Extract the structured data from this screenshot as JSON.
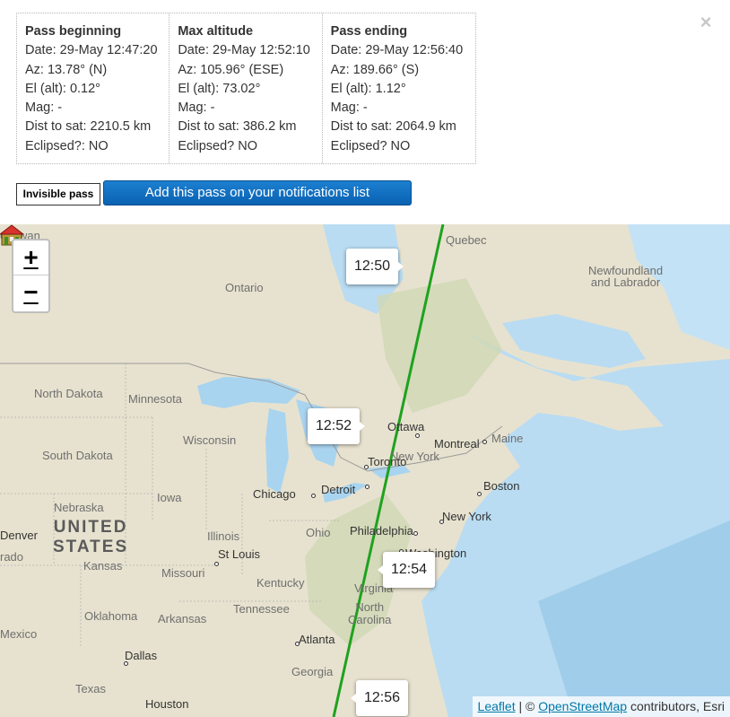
{
  "close": {
    "glyph": "×"
  },
  "pass": {
    "beginning": {
      "title": "Pass beginning",
      "date": "Date: 29-May 12:47:20",
      "az": "Az: 13.78° (N)",
      "el": "El (alt): 0.12°",
      "mag": "Mag: -",
      "dist": "Dist to sat: 2210.5 km",
      "eclipsed": "Eclipsed?: NO"
    },
    "max": {
      "title": "Max altitude",
      "date": "Date: 29-May 12:52:10",
      "az": "Az: 105.96° (ESE)",
      "el": "El (alt): 73.02°",
      "mag": "Mag: -",
      "dist": "Dist to sat: 386.2 km",
      "eclipsed": "Eclipsed? NO"
    },
    "ending": {
      "title": "Pass ending",
      "date": "Date: 29-May 12:56:40",
      "az": "Az: 189.66° (S)",
      "el": "El (alt): 1.12°",
      "mag": "Mag: -",
      "dist": "Dist to sat: 2064.9 km",
      "eclipsed": "Eclipsed? NO"
    }
  },
  "buttons": {
    "invisible": "Invisible pass",
    "add": "Add this pass on your notifications list"
  },
  "map": {
    "zoom_in": "+",
    "zoom_out": "−",
    "track_color": "#1fa21f",
    "times": [
      "12:50",
      "12:52",
      "12:54",
      "12:56"
    ],
    "places": {
      "quebec": "Quebec",
      "ontario": "Ontario",
      "newfoundland": "Newfoundland\nand Labrador",
      "north_dakota": "North Dakota",
      "minnesota": "Minnesota",
      "wisconsin": "Wisconsin",
      "south_dakota": "South Dakota",
      "nebraska": "Nebraska",
      "iowa": "Iowa",
      "united_states": "UNITED\nSTATES",
      "kansas": "Kansas",
      "illinois": "Illinois",
      "ohio": "Ohio",
      "missouri": "Missouri",
      "kentucky": "Kentucky",
      "oklahoma": "Oklahoma",
      "arkansas": "Arkansas",
      "tennessee": "Tennessee",
      "texas": "Texas",
      "georgia": "Georgia",
      "virginia": "Virginia",
      "north_carolina": "North\nCarolina",
      "maine": "Maine",
      "mexico": "Mexico",
      "colorado": "rado",
      "chewan": "chewan",
      "ottawa": "Ottawa",
      "montreal": "Montreal",
      "toronto": "Toronto",
      "new_york_state": "New York",
      "boston": "Boston",
      "new_york": "New York",
      "philadelphia": "Philadelphia",
      "washington": "Washington",
      "chicago": "Chicago",
      "detroit": "Detroit",
      "st_louis": "St Louis",
      "atlanta": "Atlanta",
      "dallas": "Dallas",
      "houston": "Houston",
      "denver": "Denver"
    },
    "attribution": {
      "leaflet": "Leaflet",
      "separator": " | © ",
      "osm": "OpenStreetMap",
      "suffix": " contributors, Esri"
    }
  }
}
